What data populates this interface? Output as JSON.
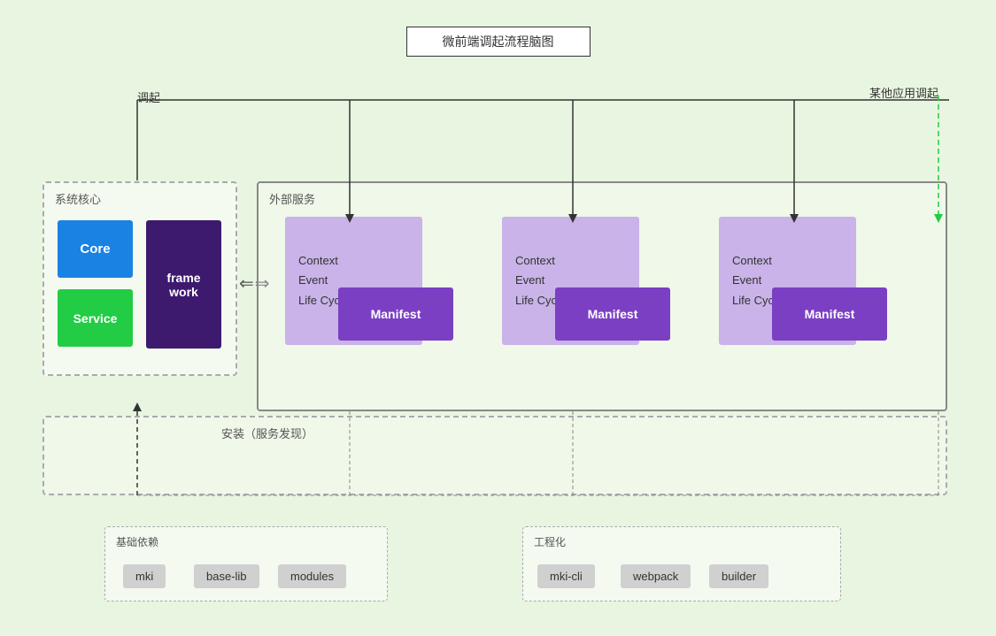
{
  "title": "微前端调起流程脑图",
  "labels": {
    "diaqi": "调起",
    "other_diaqi": "某他应用调起",
    "system_core": "系统核心",
    "external_services": "外部服务",
    "install": "安装（服务发现）",
    "foundation": "基础依赖",
    "engineering": "工程化"
  },
  "system": {
    "core": "Core",
    "service": "Service",
    "framework": "frame\nwork"
  },
  "micro_apps": [
    {
      "context": "Context",
      "event": "Event",
      "lifecycle": "Life Cycle",
      "manifest": "Manifest"
    },
    {
      "context": "Context",
      "event": "Event",
      "lifecycle": "Life Cycle",
      "manifest": "Manifest"
    },
    {
      "context": "Context",
      "event": "Event",
      "lifecycle": "Life Cycle",
      "manifest": "Manifest"
    }
  ],
  "foundation_items": [
    "mki",
    "base-lib",
    "modules"
  ],
  "engineering_items": [
    "mki-cli",
    "webpack",
    "builder"
  ],
  "double_arrow": "⇐⇒"
}
